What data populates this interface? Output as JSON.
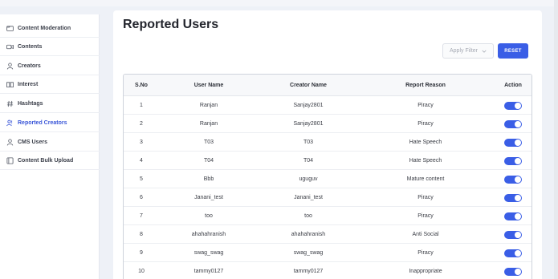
{
  "sidebar": {
    "items": [
      {
        "label": "Content Moderation",
        "icon": "folder-icon",
        "active": false
      },
      {
        "label": "Contents",
        "icon": "video-icon",
        "active": false
      },
      {
        "label": "Creators",
        "icon": "user-icon",
        "active": false
      },
      {
        "label": "Interest",
        "icon": "book-icon",
        "active": false
      },
      {
        "label": "Hashtags",
        "icon": "hashtag-icon",
        "active": false
      },
      {
        "label": "Reported Creators",
        "icon": "users-report-icon",
        "active": true
      },
      {
        "label": "CMS Users",
        "icon": "user-icon",
        "active": false
      },
      {
        "label": "Content Bulk Upload",
        "icon": "upload-icon",
        "active": false
      }
    ]
  },
  "main": {
    "title": "Reported Users",
    "filter_label": "Apply Filter",
    "reset_label": "RESET"
  },
  "table": {
    "headers": {
      "sno": "S.No",
      "user": "User Name",
      "creator": "Creator Name",
      "reason": "Report Reason",
      "action": "Action"
    },
    "rows": [
      {
        "sno": "1",
        "user": "Ranjan",
        "creator": "Sanjay2801",
        "reason": "Piracy",
        "enabled": true
      },
      {
        "sno": "2",
        "user": "Ranjan",
        "creator": "Sanjay2801",
        "reason": "Piracy",
        "enabled": true
      },
      {
        "sno": "3",
        "user": "T03",
        "creator": "T03",
        "reason": "Hate Speech",
        "enabled": true
      },
      {
        "sno": "4",
        "user": "T04",
        "creator": "T04",
        "reason": "Hate Speech",
        "enabled": true
      },
      {
        "sno": "5",
        "user": "Bbb",
        "creator": "uguguv",
        "reason": "Mature content",
        "enabled": true
      },
      {
        "sno": "6",
        "user": "Janani_test",
        "creator": "Janani_test",
        "reason": "Piracy",
        "enabled": true
      },
      {
        "sno": "7",
        "user": "too",
        "creator": "too",
        "reason": "Piracy",
        "enabled": true
      },
      {
        "sno": "8",
        "user": "ahahahranish",
        "creator": "ahahahranish",
        "reason": "Anti Social",
        "enabled": true
      },
      {
        "sno": "9",
        "user": "swag_swag",
        "creator": "swag_swag",
        "reason": "Piracy",
        "enabled": true
      },
      {
        "sno": "10",
        "user": "tammy0127",
        "creator": "tammy0127",
        "reason": "Inappropriate",
        "enabled": true
      }
    ]
  },
  "colors": {
    "accent": "#3a5ee6",
    "active_text": "#3a56d8"
  }
}
